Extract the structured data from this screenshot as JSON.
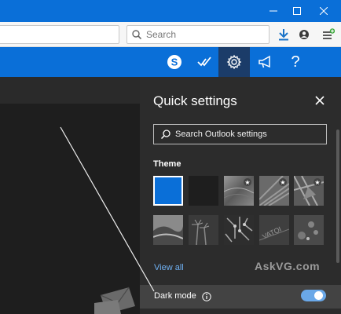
{
  "colors": {
    "titlebar": "#0a6fd8",
    "header": "#0a6fd8",
    "header_active": "#1b3c69",
    "panel": "#2c2c2c",
    "link": "#6fb0f2",
    "toggle_on": "#6aa8e8"
  },
  "window_controls": {
    "minimize_icon": "minimize-icon",
    "maximize_icon": "maximize-icon",
    "close_icon": "close-icon"
  },
  "toolbar": {
    "search_placeholder": "Search",
    "download_icon": "download-icon",
    "account_icon": "account-icon",
    "menu_icon": "hamburger-menu-icon"
  },
  "header": {
    "icons": [
      "skype-icon",
      "todo-check-icon",
      "gear-icon",
      "megaphone-icon",
      "help-icon"
    ],
    "help_label": "?"
  },
  "quick_settings": {
    "title": "Quick settings",
    "search_placeholder": "Search Outlook settings",
    "theme_label": "Theme",
    "view_all": "View all",
    "dark_mode_label": "Dark mode",
    "dark_mode_on": true,
    "theme_tiles": [
      {
        "name": "blue",
        "selected": true
      },
      {
        "name": "dark",
        "selected": false
      },
      {
        "name": "gradient-star",
        "selected": false
      },
      {
        "name": "lines-star",
        "selected": false
      },
      {
        "name": "abstract-star",
        "selected": false
      },
      {
        "name": "landscape",
        "selected": false
      },
      {
        "name": "palms",
        "selected": false
      },
      {
        "name": "circuit",
        "selected": false
      },
      {
        "name": "lettering",
        "selected": false
      },
      {
        "name": "bokeh",
        "selected": false
      }
    ]
  },
  "watermark": "AskVG.com"
}
